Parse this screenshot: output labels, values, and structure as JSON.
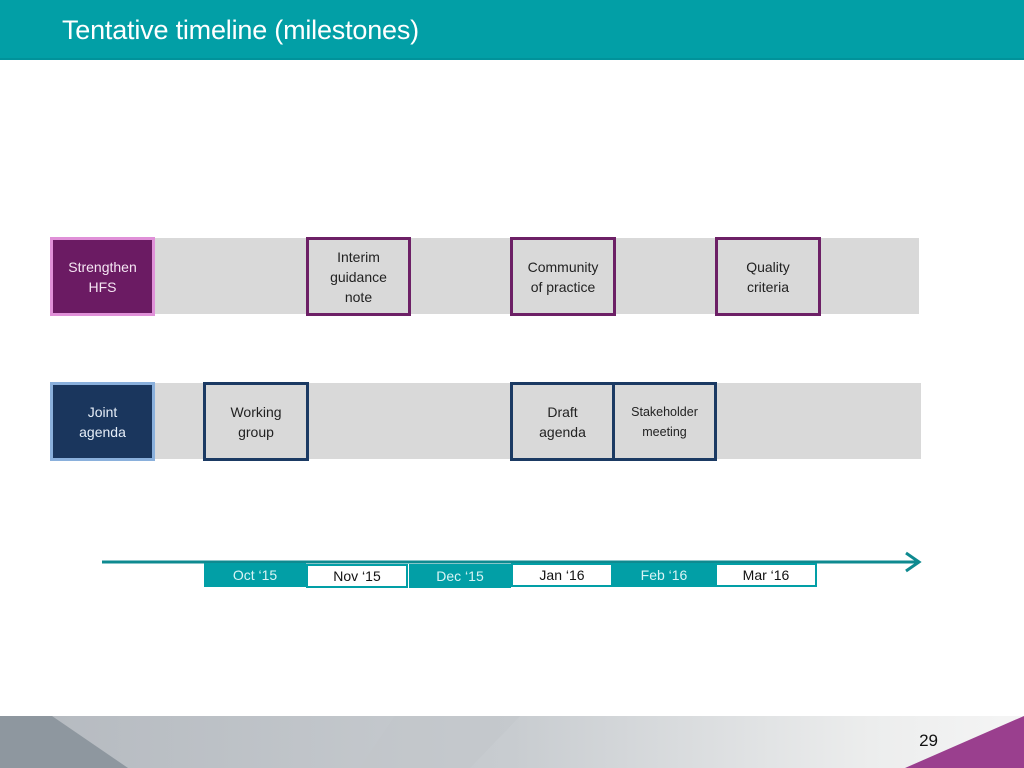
{
  "header": {
    "title": "Tentative timeline (milestones)"
  },
  "colors": {
    "teal": "#029fa6",
    "purple": "#6b1b63",
    "navy": "#1a365d",
    "lane_gray": "#d9d9d9",
    "footer_accent": "#9a3f8e"
  },
  "rows": [
    {
      "label": "Strengthen\nHFS",
      "milestones": [
        {
          "text": "Interim\nguidance\nnote",
          "month": "Nov ‘15"
        },
        {
          "text": "Community\nof practice",
          "month": "Jan ‘16"
        },
        {
          "text": "Quality\ncriteria",
          "month": "Mar ‘16"
        }
      ]
    },
    {
      "label": "Joint\nagenda",
      "milestones": [
        {
          "text": "Working\ngroup",
          "month": "Oct ‘15"
        },
        {
          "text": "Draft\nagenda",
          "month": "Jan ‘16"
        },
        {
          "text": "Stakeholder\nmeeting",
          "month": "Feb ‘16"
        }
      ]
    }
  ],
  "timeline": {
    "months": [
      "Oct ‘15",
      "Nov ‘15",
      "Dec ‘15",
      "Jan ‘16",
      "Feb ‘16",
      "Mar ‘16"
    ]
  },
  "footer": {
    "page_number": "29"
  }
}
